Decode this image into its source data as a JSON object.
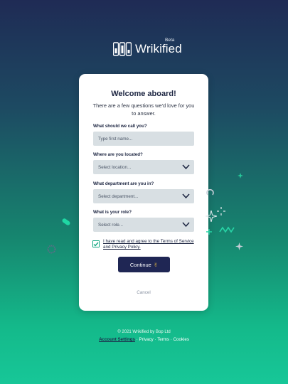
{
  "brand": {
    "name": "Wrikified",
    "badge": "Beta"
  },
  "card": {
    "title": "Welcome aboard!",
    "subtitle": "There are a few questions we'd love for you to answer."
  },
  "form": {
    "name_label": "What should we call you?",
    "name_placeholder": "Type first name...",
    "location_label": "Where are you located?",
    "location_value": "Select location...",
    "department_label": "What department are you in?",
    "department_value": "Select department...",
    "role_label": "What is your role?",
    "role_value": "Select role...",
    "terms_checked": true,
    "terms_text": "I have read and agree to the Terms of Service and Privacy Policy.",
    "continue_label": "Continue",
    "continue_emoji": "✌",
    "cancel_label": "Cancel"
  },
  "footer": {
    "copyright": "© 2021 Wrikified by Bop Ltd",
    "links": [
      "Account Settings",
      "Privacy",
      "Terms",
      "Cookies"
    ],
    "separator": "·"
  },
  "colors": {
    "primary": "#1f2654",
    "accent": "#12a781",
    "field_bg": "#d8dfe3",
    "card_bg": "#ffffff"
  },
  "icons": [
    "logo-mark-icon",
    "chevron-down-icon",
    "check-icon",
    "victory-hand-icon",
    "sparkle-icon"
  ]
}
